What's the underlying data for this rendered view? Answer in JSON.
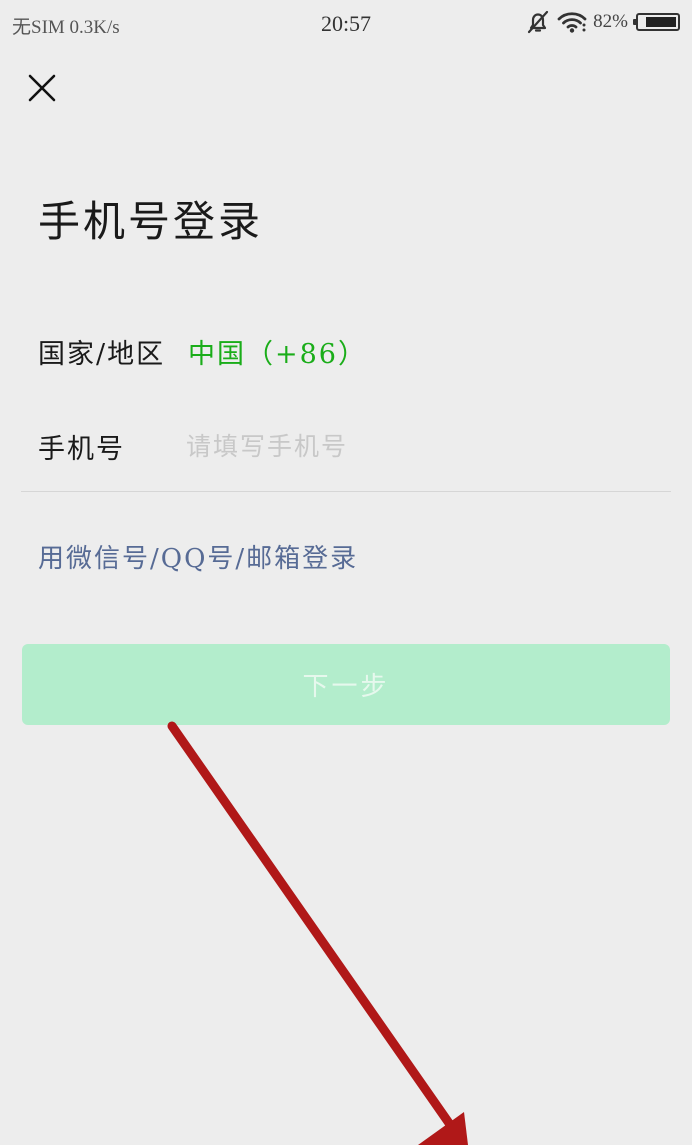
{
  "status_bar": {
    "carrier": "无SIM",
    "network_speed": "0.3K/s",
    "time": "20:57",
    "battery_percent_label": "82%",
    "battery_level": 0.82,
    "icons": [
      "alarm-off-icon",
      "wifi-icon",
      "battery-icon"
    ]
  },
  "header": {
    "close_icon": "close-icon",
    "title": "手机号登录"
  },
  "form": {
    "region_label": "国家/地区",
    "region_value": "中国（+86）",
    "phone_label": "手机号",
    "phone_value": "",
    "phone_placeholder": "请填写手机号"
  },
  "alt_login_link": "用微信号/QQ号/邮箱登录",
  "next_button": {
    "label": "下一步",
    "enabled": false
  },
  "colors": {
    "background": "#ededed",
    "accent_green": "#1aad19",
    "link_blue": "#576b95",
    "disabled_button": "#b3edcc",
    "annotation_arrow": "#b01818"
  }
}
